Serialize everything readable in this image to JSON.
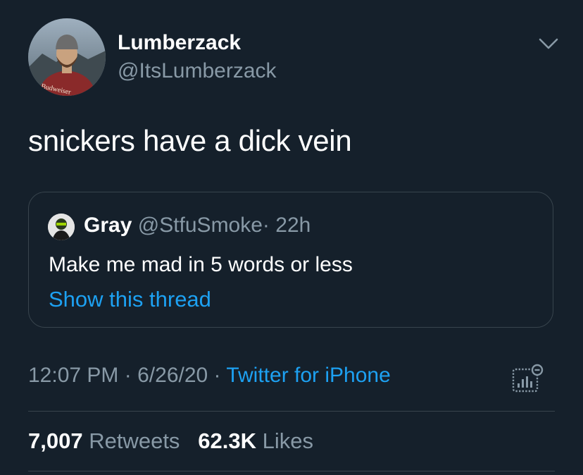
{
  "tweet": {
    "author_name": "Lumberzack",
    "author_handle": "@ItsLumberzack",
    "avatar_shirt_text": "Budweiser",
    "text": "snickers have a dick vein",
    "time": "12:07 PM",
    "date": "6/26/20",
    "source": "Twitter for iPhone",
    "separator": "·"
  },
  "quoted": {
    "name": "Gray",
    "handle": "@StfuSmoke",
    "separator": "·",
    "age": "22h",
    "text": "Make me mad in 5 words or less",
    "link": "Show this thread"
  },
  "stats": {
    "retweets_count": "7,007",
    "retweets_label": "Retweets",
    "likes_count": "62.3K",
    "likes_label": "Likes"
  },
  "icons": {
    "caret": "chevron-down-icon",
    "analytics": "tweet-analytics-icon"
  },
  "colors": {
    "background": "#15202b",
    "accent": "#1da1f2",
    "secondary_text": "#8899a6",
    "border": "#38444d"
  }
}
